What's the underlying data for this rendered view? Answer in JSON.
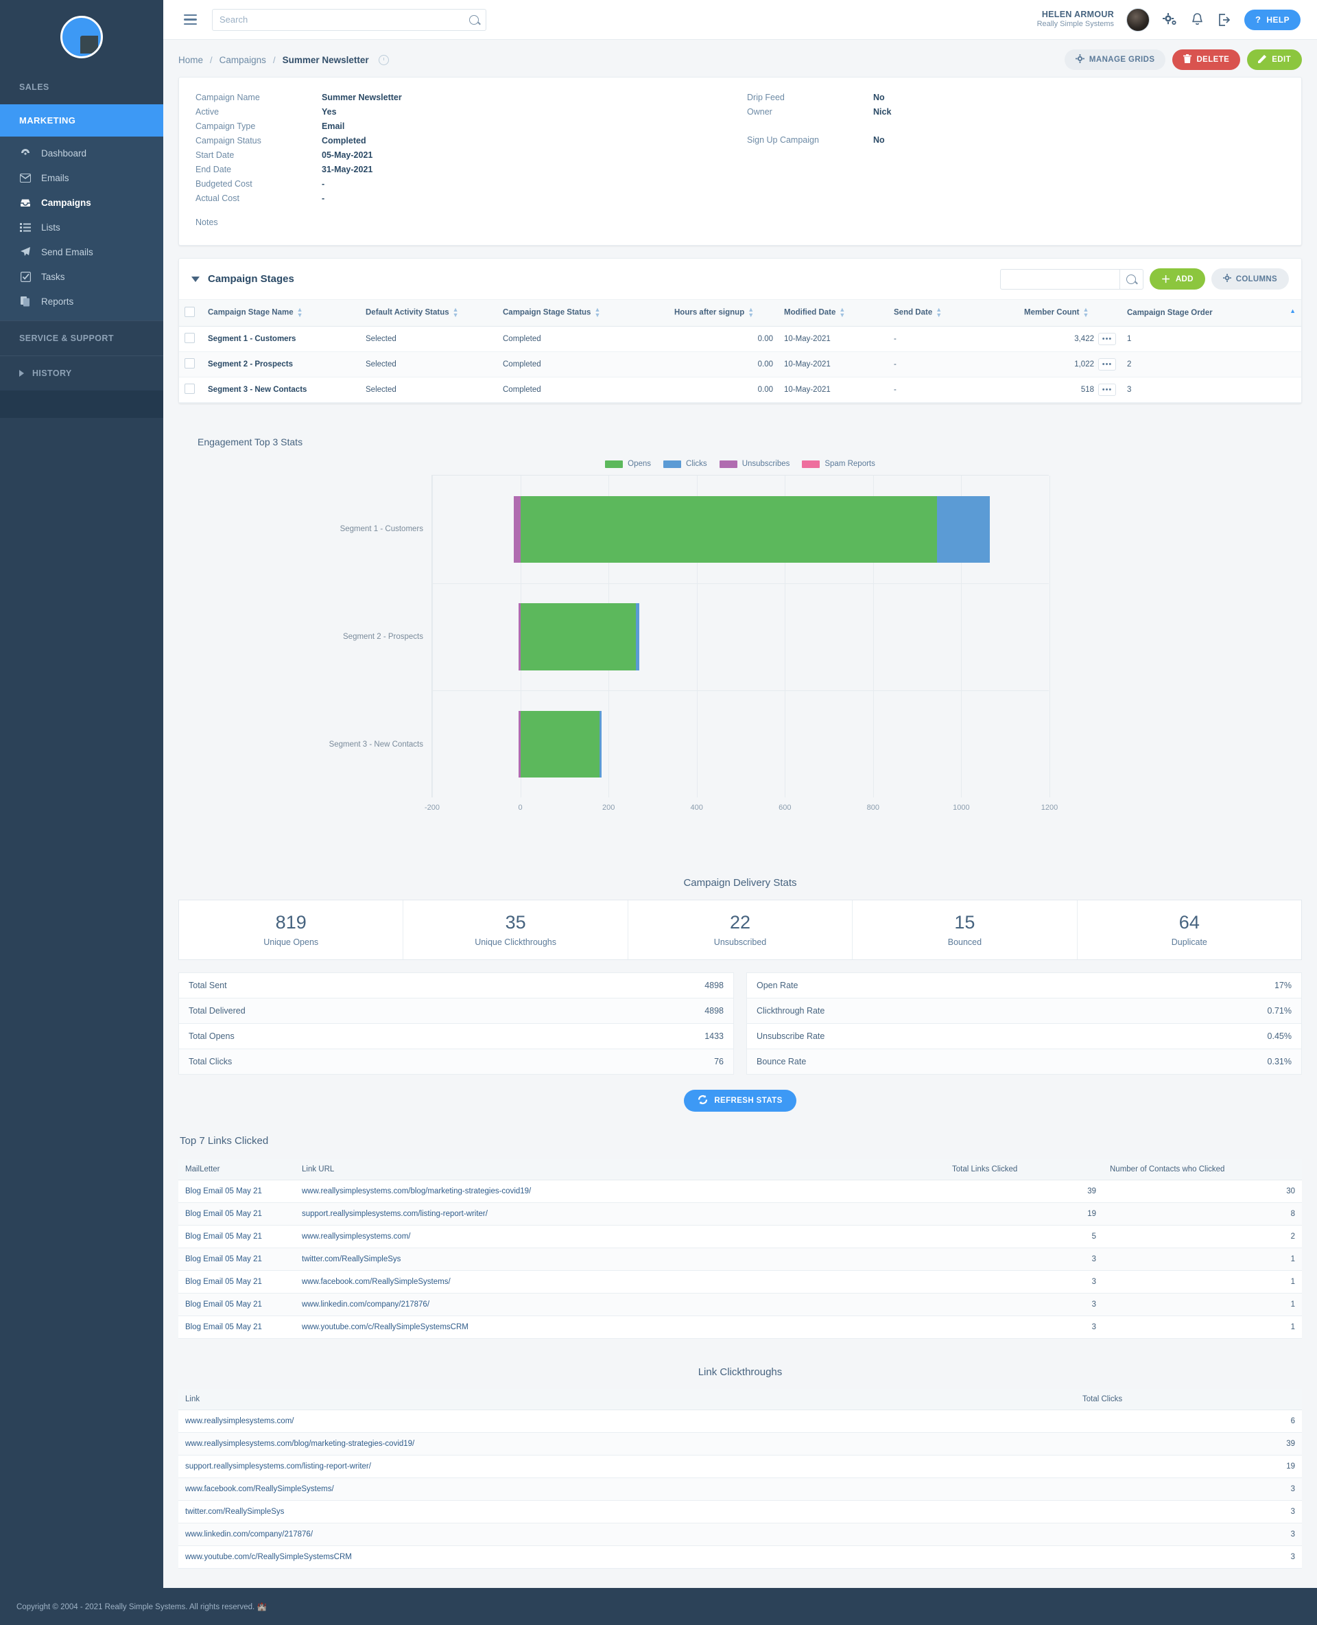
{
  "sidebar": {
    "logo_icon": "pie-chart-logo",
    "sections": [
      {
        "label": "SALES",
        "active": false
      },
      {
        "label": "MARKETING",
        "active": true
      },
      {
        "label": "SERVICE & SUPPORT",
        "active": false
      }
    ],
    "items": [
      {
        "label": "Dashboard",
        "icon": "dashboard-icon",
        "selected": false
      },
      {
        "label": "Emails",
        "icon": "envelope-icon",
        "selected": false
      },
      {
        "label": "Campaigns",
        "icon": "inbox-icon",
        "selected": true
      },
      {
        "label": "Lists",
        "icon": "list-icon",
        "selected": false
      },
      {
        "label": "Send Emails",
        "icon": "paper-plane-icon",
        "selected": false
      },
      {
        "label": "Tasks",
        "icon": "check-square-icon",
        "selected": false
      },
      {
        "label": "Reports",
        "icon": "documents-icon",
        "selected": false
      }
    ],
    "history_label": "HISTORY"
  },
  "topbar": {
    "search_placeholder": "Search",
    "search_value": "",
    "user_name": "HELEN ARMOUR",
    "user_org": "Really Simple Systems",
    "help_label": "HELP",
    "icons": [
      "gears-icon",
      "bell-icon",
      "logout-icon"
    ]
  },
  "breadcrumb": {
    "home": "Home",
    "campaigns": "Campaigns",
    "current": "Summer Newsletter",
    "separator": "/"
  },
  "actions": {
    "manage_grids": "MANAGE GRIDS",
    "delete": "DELETE",
    "edit": "EDIT"
  },
  "detail": {
    "left": [
      {
        "label": "Campaign Name",
        "value": "Summer Newsletter"
      },
      {
        "label": "Active",
        "value": "Yes"
      },
      {
        "label": "Campaign Type",
        "value": "Email"
      },
      {
        "label": "Campaign Status",
        "value": "Completed"
      },
      {
        "label": "Start Date",
        "value": "05-May-2021"
      },
      {
        "label": "End Date",
        "value": "31-May-2021"
      },
      {
        "label": "Budgeted Cost",
        "value": "-"
      },
      {
        "label": "Actual Cost",
        "value": "-"
      }
    ],
    "right": [
      {
        "label": "Drip Feed",
        "value": "No"
      },
      {
        "label": "Owner",
        "value": "Nick"
      },
      {
        "label": "",
        "value": ""
      },
      {
        "label": "Sign Up Campaign",
        "value": "No"
      }
    ],
    "notes_label": "Notes"
  },
  "stages": {
    "title": "Campaign Stages",
    "search_value": "",
    "add_label": "ADD",
    "columns_label": "COLUMNS",
    "headers": [
      "Campaign Stage Name",
      "Default Activity Status",
      "Campaign Stage Status",
      "Hours after signup",
      "Modified Date",
      "Send Date",
      "Member Count",
      "Campaign Stage Order"
    ],
    "rows": [
      {
        "name": "Segment 1 - Customers",
        "default_activity_status": "Selected",
        "stage_status": "Completed",
        "hours_after_signup": "0.00",
        "modified_date": "10-May-2021",
        "send_date": "-",
        "member_count": "3,422",
        "order": "1"
      },
      {
        "name": "Segment 2 - Prospects",
        "default_activity_status": "Selected",
        "stage_status": "Completed",
        "hours_after_signup": "0.00",
        "modified_date": "10-May-2021",
        "send_date": "-",
        "member_count": "1,022",
        "order": "2"
      },
      {
        "name": "Segment 3 - New Contacts",
        "default_activity_status": "Selected",
        "stage_status": "Completed",
        "hours_after_signup": "0.00",
        "modified_date": "10-May-2021",
        "send_date": "-",
        "member_count": "518",
        "order": "3"
      }
    ]
  },
  "chart_data": {
    "type": "bar",
    "orientation": "horizontal",
    "stacked": true,
    "title": "Engagement Top 3 Stats",
    "xlabel": "",
    "ylabel": "",
    "xlim": [
      -200,
      1200
    ],
    "xticks": [
      -200,
      0,
      200,
      400,
      600,
      800,
      1000,
      1200
    ],
    "grid": true,
    "legend_position": "top-center",
    "categories": [
      "Segment 1 - Customers",
      "Segment 2 - Prospects",
      "Segment 3 - New Contacts"
    ],
    "series": [
      {
        "name": "Opens",
        "color": "#5cb85c",
        "values": [
          945,
          262,
          180
        ]
      },
      {
        "name": "Clicks",
        "color": "#5b9bd5",
        "values": [
          120,
          8,
          5
        ]
      },
      {
        "name": "Unsubscribes",
        "color": "#b06cb0",
        "values": [
          15,
          4,
          4
        ]
      },
      {
        "name": "Spam Reports",
        "color": "#ee6f9e",
        "values": [
          0,
          0,
          0
        ]
      }
    ]
  },
  "delivery": {
    "title": "Campaign Delivery Stats",
    "kpis": [
      {
        "value": "819",
        "label": "Unique Opens"
      },
      {
        "value": "35",
        "label": "Unique Clickthroughs"
      },
      {
        "value": "22",
        "label": "Unsubscribed"
      },
      {
        "value": "15",
        "label": "Bounced"
      },
      {
        "value": "64",
        "label": "Duplicate"
      }
    ],
    "left_stats": [
      {
        "label": "Total Sent",
        "value": "4898"
      },
      {
        "label": "Total Delivered",
        "value": "4898"
      },
      {
        "label": "Total Opens",
        "value": "1433"
      },
      {
        "label": "Total Clicks",
        "value": "76"
      }
    ],
    "right_stats": [
      {
        "label": "Open Rate",
        "value": "17%"
      },
      {
        "label": "Clickthrough Rate",
        "value": "0.71%"
      },
      {
        "label": "Unsubscribe Rate",
        "value": "0.45%"
      },
      {
        "label": "Bounce Rate",
        "value": "0.31%"
      }
    ],
    "refresh_label": "REFRESH STATS"
  },
  "top_links": {
    "title": "Top 7 Links Clicked",
    "headers": [
      "MailLetter",
      "Link URL",
      "Total Links Clicked",
      "Number of Contacts who Clicked"
    ],
    "rows": [
      {
        "mailletter": "Blog Email 05 May 21",
        "url": "www.reallysimplesystems.com/blog/marketing-strategies-covid19/",
        "clicks": "39",
        "contacts": "30"
      },
      {
        "mailletter": "Blog Email 05 May 21",
        "url": "support.reallysimplesystems.com/listing-report-writer/",
        "clicks": "19",
        "contacts": "8"
      },
      {
        "mailletter": "Blog Email 05 May 21",
        "url": "www.reallysimplesystems.com/",
        "clicks": "5",
        "contacts": "2"
      },
      {
        "mailletter": "Blog Email 05 May 21",
        "url": "twitter.com/ReallySimpleSys",
        "clicks": "3",
        "contacts": "1"
      },
      {
        "mailletter": "Blog Email 05 May 21",
        "url": "www.facebook.com/ReallySimpleSystems/",
        "clicks": "3",
        "contacts": "1"
      },
      {
        "mailletter": "Blog Email 05 May 21",
        "url": "www.linkedin.com/company/217876/",
        "clicks": "3",
        "contacts": "1"
      },
      {
        "mailletter": "Blog Email 05 May 21",
        "url": "www.youtube.com/c/ReallySimpleSystemsCRM",
        "clicks": "3",
        "contacts": "1"
      }
    ]
  },
  "clickthroughs": {
    "title": "Link Clickthroughs",
    "headers": [
      "Link",
      "Total Clicks"
    ],
    "rows": [
      {
        "link": "www.reallysimplesystems.com/",
        "clicks": "6"
      },
      {
        "link": "www.reallysimplesystems.com/blog/marketing-strategies-covid19/",
        "clicks": "39"
      },
      {
        "link": "support.reallysimplesystems.com/listing-report-writer/",
        "clicks": "19"
      },
      {
        "link": "www.facebook.com/ReallySimpleSystems/",
        "clicks": "3"
      },
      {
        "link": "twitter.com/ReallySimpleSys",
        "clicks": "3"
      },
      {
        "link": "www.linkedin.com/company/217876/",
        "clicks": "3"
      },
      {
        "link": "www.youtube.com/c/ReallySimpleSystemsCRM",
        "clicks": "3"
      }
    ]
  },
  "footer": {
    "text": "Copyright © 2004 - 2021 Really Simple Systems. All rights reserved.",
    "icon": "castle-icon"
  }
}
